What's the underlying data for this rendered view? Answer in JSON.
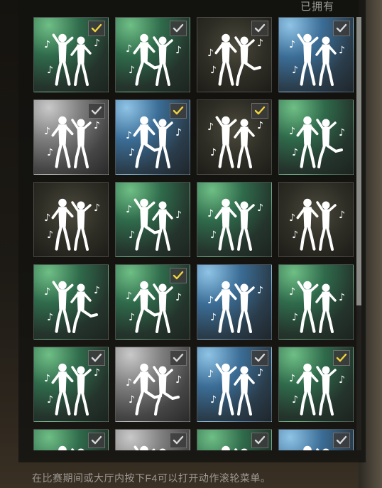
{
  "header": {
    "owned_label": "已拥有"
  },
  "footer": {
    "hint": "在比赛期间或大厅内按下F4可以打开动作滚轮菜单。"
  },
  "colors": {
    "check_yellow": "#f2d33b",
    "check_white": "#d8d8d8"
  },
  "grid": {
    "emotes": [
      {
        "bg": "green",
        "check": "yellow"
      },
      {
        "bg": "green",
        "check": "white"
      },
      {
        "bg": "olive",
        "check": "white"
      },
      {
        "bg": "blue",
        "check": "white"
      },
      {
        "bg": "gray",
        "check": "white"
      },
      {
        "bg": "blue",
        "check": "yellow"
      },
      {
        "bg": "olive",
        "check": "yellow"
      },
      {
        "bg": "green",
        "check": "none"
      },
      {
        "bg": "olive",
        "check": "none"
      },
      {
        "bg": "green",
        "check": "none"
      },
      {
        "bg": "green",
        "check": "none"
      },
      {
        "bg": "olive",
        "check": "none"
      },
      {
        "bg": "green",
        "check": "none"
      },
      {
        "bg": "green",
        "check": "yellow"
      },
      {
        "bg": "blue",
        "check": "none"
      },
      {
        "bg": "green",
        "check": "none"
      },
      {
        "bg": "green",
        "check": "white"
      },
      {
        "bg": "gray",
        "check": "white"
      },
      {
        "bg": "blue",
        "check": "white"
      },
      {
        "bg": "green",
        "check": "yellow"
      },
      {
        "bg": "green",
        "check": "white"
      },
      {
        "bg": "gray",
        "check": "white"
      },
      {
        "bg": "green",
        "check": "white"
      },
      {
        "bg": "blue",
        "check": "white"
      }
    ]
  }
}
